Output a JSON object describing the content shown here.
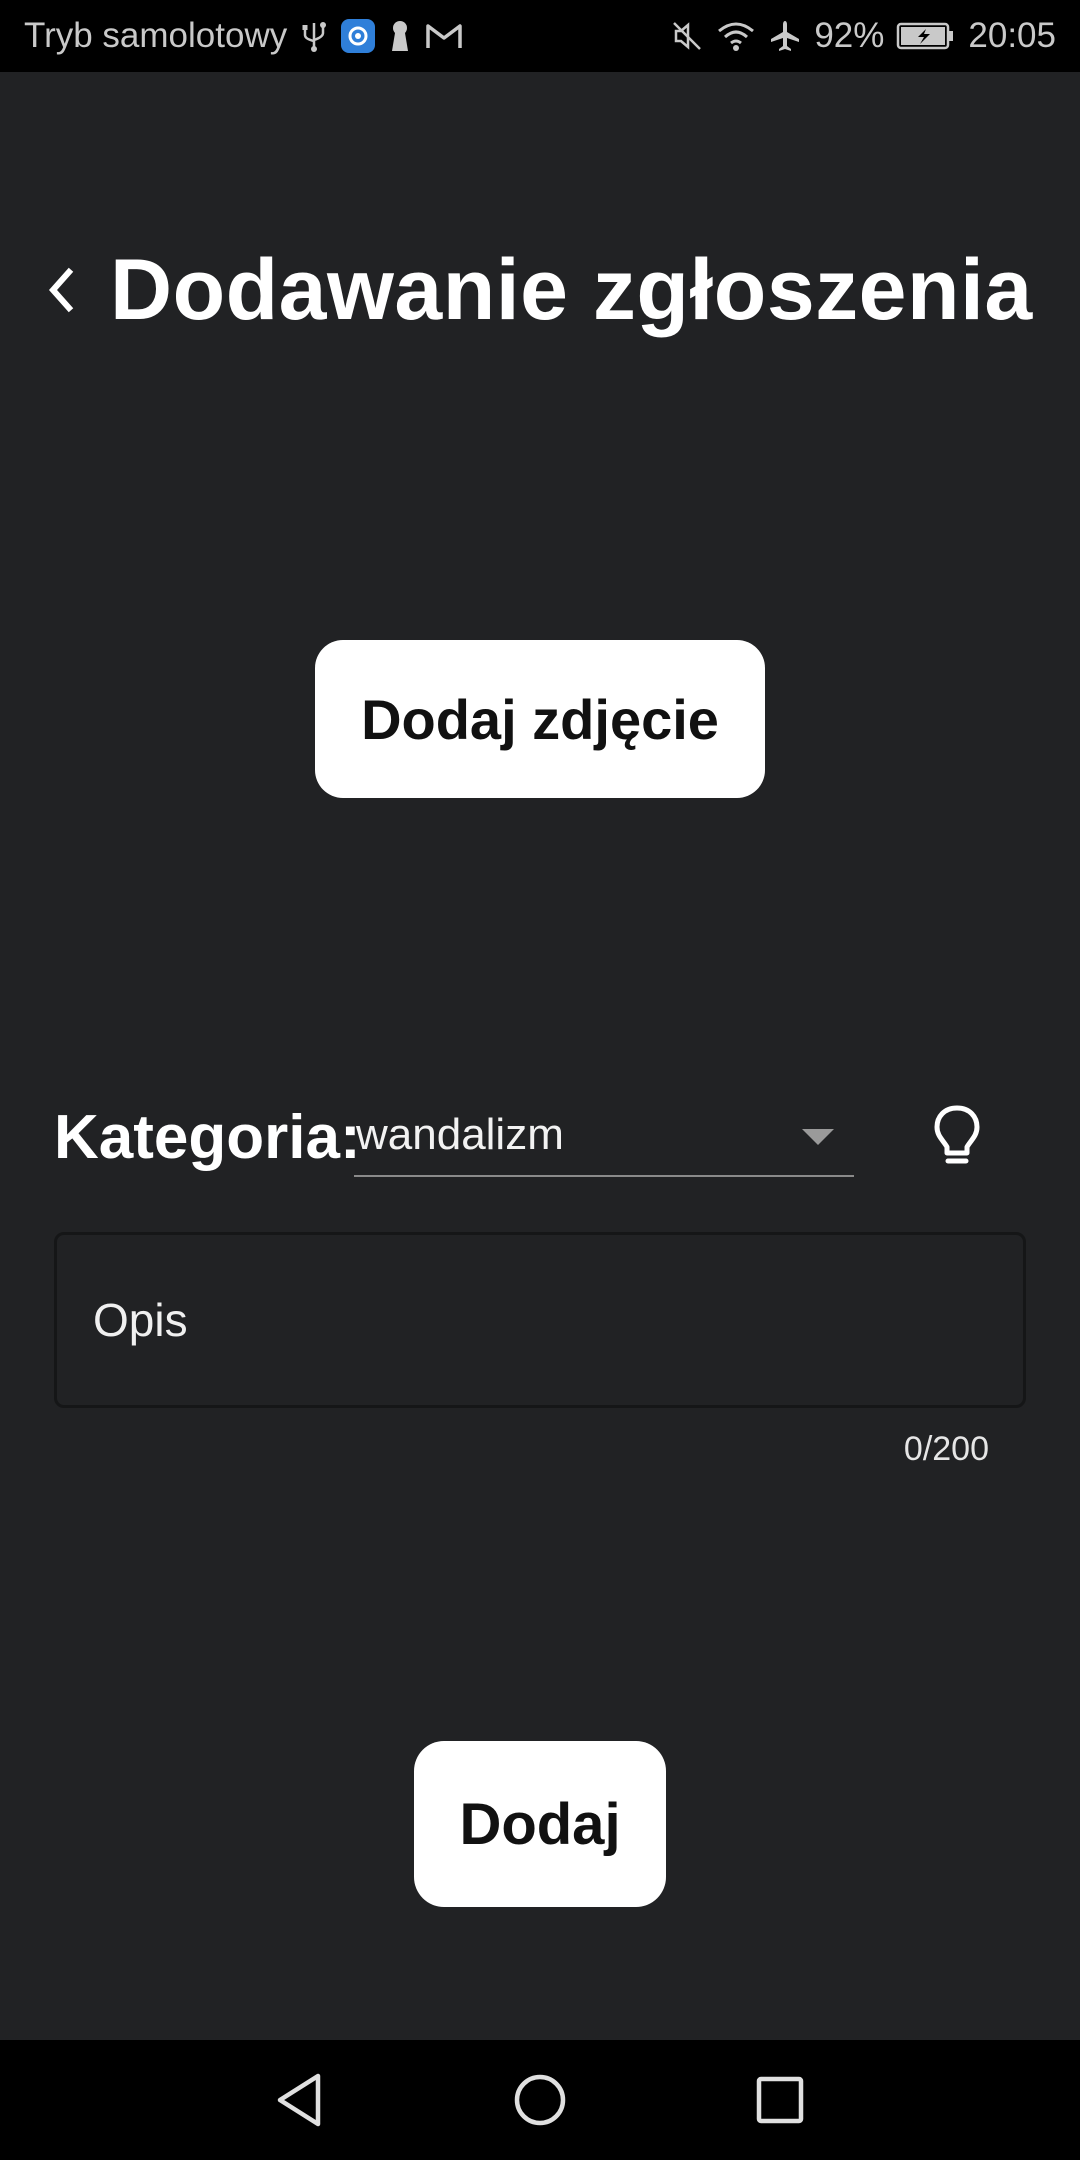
{
  "status_bar": {
    "carrier_text": "Tryb samolotowy",
    "battery_percent": "92%",
    "time": "20:05",
    "left_icons": [
      "usb-icon",
      "app-notification-icon",
      "keyhole-icon",
      "gmail-icon"
    ],
    "right_icons": [
      "mute-icon",
      "wifi-icon",
      "airplane-icon",
      "battery-charging-icon"
    ]
  },
  "header": {
    "title": "Dodawanie zgłoszenia",
    "back_icon": "chevron-left-icon"
  },
  "photo_button": {
    "label": "Dodaj zdjęcie"
  },
  "category": {
    "label": "Kategoria:",
    "selected_value": "wandalizm",
    "hint_icon": "lightbulb-icon"
  },
  "description": {
    "placeholder": "Opis",
    "counter": "0/200"
  },
  "submit_button": {
    "label": "Dodaj"
  },
  "nav_bar": {
    "icons": [
      "back-triangle-icon",
      "home-circle-icon",
      "recents-square-icon"
    ]
  },
  "colors": {
    "background": "#212224",
    "bars": "#000000",
    "button_bg": "#ffffff",
    "button_text": "#111111"
  }
}
